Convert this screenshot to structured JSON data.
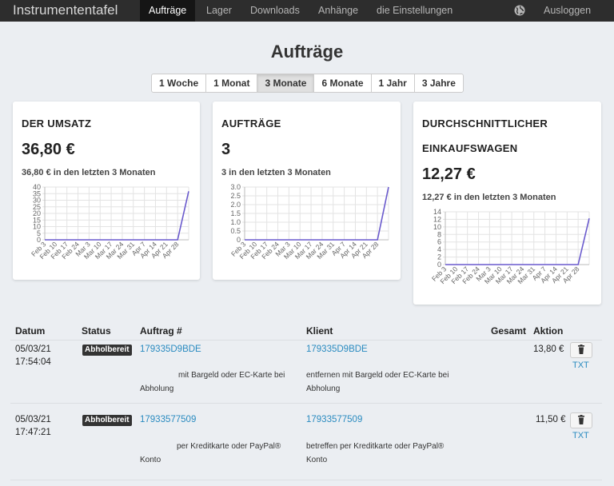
{
  "nav": {
    "brand": "Instrumententafel",
    "items": [
      {
        "label": "Aufträge",
        "active": true
      },
      {
        "label": "Lager",
        "active": false
      },
      {
        "label": "Downloads",
        "active": false
      },
      {
        "label": "Anhänge",
        "active": false
      },
      {
        "label": "die Einstellungen",
        "active": false
      }
    ],
    "globe_icon": "globe-icon",
    "logout": "Ausloggen"
  },
  "page": {
    "title": "Aufträge"
  },
  "ranges": [
    "1 Woche",
    "1 Monat",
    "3 Monate",
    "6 Monate",
    "1 Jahr",
    "3 Jahre"
  ],
  "active_range": "3 Monate",
  "cards": [
    {
      "title": "DER UMSATZ",
      "value": "36,80 €",
      "sub": "36,80 € in den letzten 3 Monaten"
    },
    {
      "title": "AUFTRÄGE",
      "value": "3",
      "sub": "3 in den letzten 3 Monaten"
    },
    {
      "title": "DURCHSCHNITTLICHER",
      "title2": "EINKAUFSWAGEN",
      "value": "12,27 €",
      "sub": "12,27 € in den letzten 3 Monaten"
    }
  ],
  "chart_data": [
    {
      "type": "line",
      "x": [
        "Feb 3",
        "Feb 10",
        "Feb 17",
        "Feb 24",
        "Mar 3",
        "Mar 10",
        "Mar 17",
        "Mar 24",
        "Mar 31",
        "Apr 7",
        "Apr 14",
        "Apr 21",
        "Apr 28",
        ""
      ],
      "values": [
        0,
        0,
        0,
        0,
        0,
        0,
        0,
        0,
        0,
        0,
        0,
        0,
        0,
        36.8
      ],
      "y_ticks": [
        "0",
        "5",
        "10",
        "15",
        "20",
        "25",
        "30",
        "35",
        "40"
      ],
      "ylim": [
        0,
        40
      ],
      "grid": true,
      "color": "#6a5acd"
    },
    {
      "type": "line",
      "x": [
        "Feb 3",
        "Feb 10",
        "Feb 17",
        "Feb 24",
        "Mar 3",
        "Mar 10",
        "Mar 17",
        "Mar 24",
        "Mar 31",
        "Apr 7",
        "Apr 14",
        "Apr 21",
        "Apr 28",
        ""
      ],
      "values": [
        0,
        0,
        0,
        0,
        0,
        0,
        0,
        0,
        0,
        0,
        0,
        0,
        0,
        3
      ],
      "y_ticks": [
        "0",
        "0.5",
        "1.0",
        "1.5",
        "2.0",
        "2.5",
        "3.0"
      ],
      "ylim": [
        0,
        3
      ],
      "grid": true,
      "color": "#6a5acd"
    },
    {
      "type": "line",
      "x": [
        "Feb 3",
        "Feb 10",
        "Feb 17",
        "Feb 24",
        "Mar 3",
        "Mar 10",
        "Mar 17",
        "Mar 24",
        "Mar 31",
        "Apr 7",
        "Apr 14",
        "Apr 21",
        "Apr 28",
        ""
      ],
      "values": [
        0,
        0,
        0,
        0,
        0,
        0,
        0,
        0,
        0,
        0,
        0,
        0,
        0,
        12.27
      ],
      "y_ticks": [
        "0",
        "2",
        "4",
        "6",
        "8",
        "10",
        "12",
        "14"
      ],
      "ylim": [
        0,
        14
      ],
      "grid": true,
      "color": "#6a5acd"
    }
  ],
  "table": {
    "headers": {
      "datum": "Datum",
      "status": "Status",
      "auftrag": "Auftrag #",
      "klient": "Klient",
      "gesamt": "Gesamt",
      "aktion": "Aktion"
    },
    "rows": [
      {
        "date": "05/03/21",
        "time": "17:54:04",
        "status": "Abholbereit",
        "order_id": "179335D9BDE",
        "client_id": "179335D9BDE",
        "order_note_1": "mit Bargeld oder EC-Karte bei",
        "order_note_2": "Abholung",
        "client_note_1": "entfernen mit Bargeld oder EC-Karte bei",
        "client_note_2": "Abholung",
        "total": "13,80 €",
        "trash_icon": "trash-icon",
        "txt": "TXT"
      },
      {
        "date": "05/03/21",
        "time": "17:47:21",
        "status": "Abholbereit",
        "order_id": "17933577509",
        "client_id": "17933577509",
        "order_note_1": "per Kreditkarte oder PayPal®",
        "order_note_2": "Konto",
        "client_note_1": "betreffen per Kreditkarte oder PayPal®",
        "client_note_2": "Konto",
        "total": "11,50 €",
        "trash_icon": "trash-icon",
        "txt": "TXT"
      }
    ]
  }
}
